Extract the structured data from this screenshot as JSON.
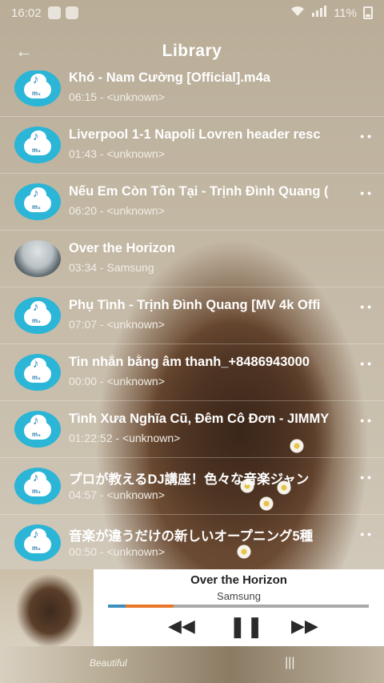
{
  "status_bar": {
    "time": "16:02",
    "battery": "11%"
  },
  "header": {
    "back_icon": "arrow-left-icon",
    "title": "Library"
  },
  "tracks": [
    {
      "title": "Khó - Nam Cường [Official].m4a",
      "sub": "06:15 - <unknown>",
      "art": "mp3-cloud-icon",
      "more": false
    },
    {
      "title": "Liverpool 1-1 Napoli  Lovren header resc",
      "sub": "01:43 - <unknown>",
      "art": "mp3-cloud-icon",
      "more": true
    },
    {
      "title": "Nếu Em Còn Tồn Tại - Trịnh Đình Quang (",
      "sub": "06:20 - <unknown>",
      "art": "mp3-cloud-icon",
      "more": true
    },
    {
      "title": "Over the Horizon",
      "sub": "03:34 - Samsung",
      "art": "album-photo",
      "more": false
    },
    {
      "title": "Phụ Tình - Trịnh Đình Quang [MV 4k Offi",
      "sub": "07:07 - <unknown>",
      "art": "mp3-cloud-icon",
      "more": true
    },
    {
      "title": "Tin nhắn bằng âm thanh_+8486943000",
      "sub": "00:00 - <unknown>",
      "art": "mp3-cloud-icon",
      "more": true
    },
    {
      "title": "Tình Xưa Nghĩa Cũ, Đêm Cô Đơn - JIMMY",
      "sub": "01:22:52 - <unknown>",
      "art": "mp3-cloud-icon",
      "more": true
    },
    {
      "title": "プロが教えるDJ講座！色々な音楽ジャン",
      "sub": "04:57 - <unknown>",
      "art": "mp3-cloud-icon",
      "more": true
    },
    {
      "title": "音楽が違うだけの新しいオープニング5種",
      "sub": "00:50 - <unknown>",
      "art": "mp3-cloud-icon",
      "more": true
    }
  ],
  "player": {
    "title": "Over the Horizon",
    "artist": "Samsung",
    "progress": 0.25,
    "prev_icon": "rewind-icon",
    "pause_icon": "pause-icon",
    "next_icon": "fast-forward-icon"
  },
  "bottom": {
    "signature": "Beautiful"
  },
  "colors": {
    "accent_orange": "#e9772a",
    "accent_blue": "#3e8fc0",
    "thumb_blue": "#2bb5d6"
  }
}
